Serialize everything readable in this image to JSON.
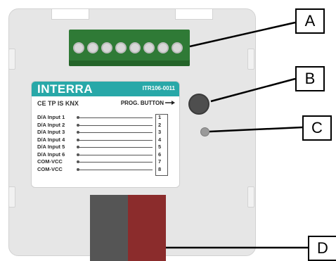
{
  "device": {
    "brand": "INTERRA",
    "model": "ITR106-0011",
    "certifications": "CE TP IS KNX",
    "prog_label": "PROG. BUTTON",
    "inputs": [
      {
        "label": "D/A Input 1",
        "num": "1"
      },
      {
        "label": "D/A Input 2",
        "num": "2"
      },
      {
        "label": "D/A Input 3",
        "num": "3"
      },
      {
        "label": "D/A Input 4",
        "num": "4"
      },
      {
        "label": "D/A Input 5",
        "num": "5"
      },
      {
        "label": "D/A Input 6",
        "num": "6"
      },
      {
        "label": "COM-VCC",
        "num": "7"
      },
      {
        "label": "COM-VCC",
        "num": "8"
      }
    ]
  },
  "callouts": {
    "a": "A",
    "b": "B",
    "c": "C",
    "d": "D"
  },
  "colors": {
    "label_band": "#28a8a8",
    "terminal_green": "#2f7a36",
    "connector_grey": "#555555",
    "connector_red": "#8b2c2c"
  }
}
